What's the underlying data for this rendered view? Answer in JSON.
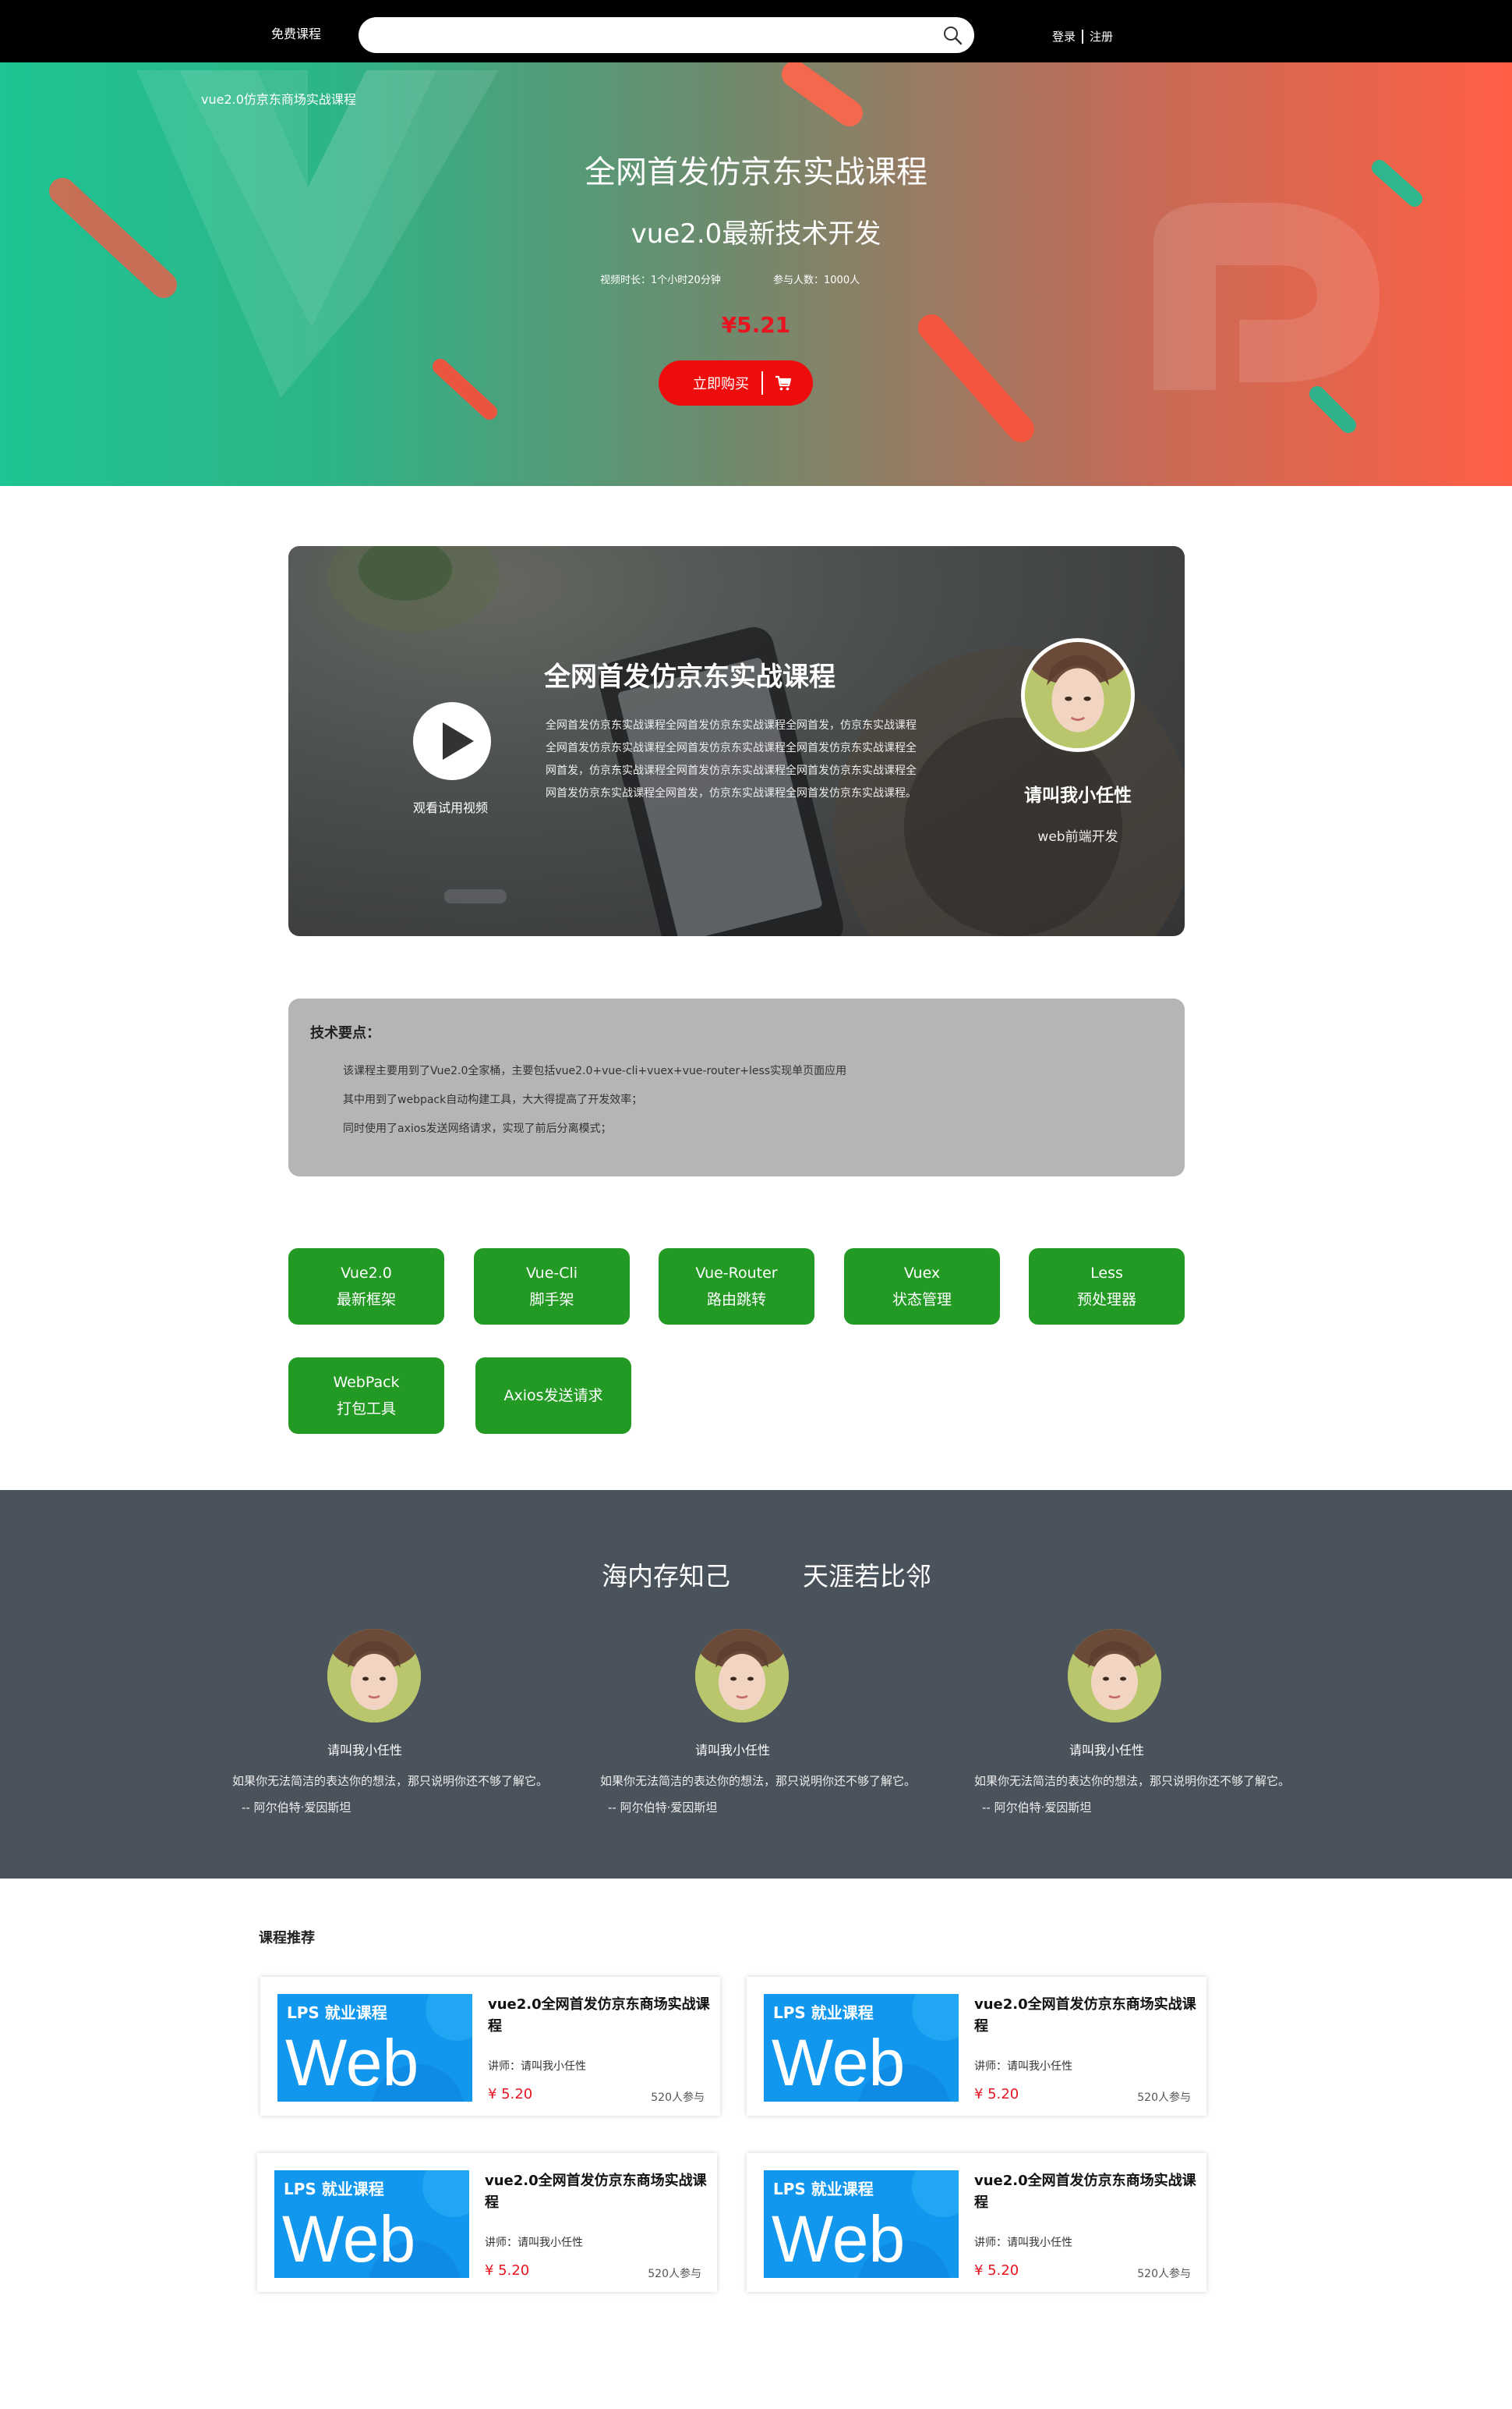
{
  "topbar": {
    "free_course": "免费课程",
    "search_value": "",
    "search_placeholder": "",
    "login": "登录",
    "register": "注册"
  },
  "hero": {
    "breadcrumb": "vue2.0仿京东商场实战课程",
    "title": "全网首发仿京东实战课程",
    "subtitle": "vue2.0最新技术开发",
    "duration": "视频时长：1个小时20分钟",
    "participants": "参与人数：1000人",
    "price": "¥5.21",
    "buy_label": "立即购买",
    "colors": {
      "start": "#1ec493",
      "end": "#ff5f45"
    }
  },
  "intro": {
    "play_label": "观看试用视频",
    "title": "全网首发仿京东实战课程",
    "description": "全网首发仿京东实战课程全网首发仿京东实战课程全网首发，仿京东实战课程全网首发仿京东实战课程全网首发仿京东实战课程全网首发仿京东实战课程全网首发，仿京东实战课程全网首发仿京东实战课程全网首发仿京东实战课程全网首发仿京东实战课程全网首发，仿京东实战课程全网首发仿京东实战课程。",
    "teacher_name": "请叫我小任性",
    "teacher_role": "web前端开发"
  },
  "tech": {
    "heading": "技术要点：",
    "lines": [
      "该课程主要用到了Vue2.0全家桶，主要包括vue2.0+vue-cli+vuex+vue-router+less实现单页面应用",
      "其中用到了webpack自动构建工具，大大得提高了开发效率；",
      "同时使用了axios发送网络请求，实现了前后分离模式；"
    ]
  },
  "tags": [
    {
      "line1": "Vue2.0",
      "line2": "最新框架"
    },
    {
      "line1": "Vue-Cli",
      "line2": "脚手架"
    },
    {
      "line1": "Vue-Router",
      "line2": "路由跳转"
    },
    {
      "line1": "Vuex",
      "line2": "状态管理"
    },
    {
      "line1": "Less",
      "line2": "预处理器"
    },
    {
      "line1": "WebPack",
      "line2": "打包工具"
    },
    {
      "line1": "Axios发送请求",
      "line2": ""
    }
  ],
  "band": {
    "left": "海内存知己",
    "right": "天涯若比邻",
    "people": [
      {
        "name": "请叫我小任性",
        "quote": "如果你无法简洁的表达你的想法，那只说明你还不够了解它。",
        "author": "-- 阿尔伯特·爱因斯坦"
      },
      {
        "name": "请叫我小任性",
        "quote": "如果你无法简洁的表达你的想法，那只说明你还不够了解它。",
        "author": "-- 阿尔伯特·爱因斯坦"
      },
      {
        "name": "请叫我小任性",
        "quote": "如果你无法简洁的表达你的想法，那只说明你还不够了解它。",
        "author": "-- 阿尔伯特·爱因斯坦"
      }
    ]
  },
  "recommend": {
    "heading": "课程推荐",
    "courses": [
      {
        "badge": "LPS 就业课程",
        "logo": "Web",
        "title": "vue2.0全网首发仿京东商场实战课程",
        "teacher": "讲师：请叫我小任性",
        "price": "¥ 5.20",
        "joined": "520人参与"
      },
      {
        "badge": "LPS 就业课程",
        "logo": "Web",
        "title": "vue2.0全网首发仿京东商场实战课程",
        "teacher": "讲师：请叫我小任性",
        "price": "¥ 5.20",
        "joined": "520人参与"
      },
      {
        "badge": "LPS 就业课程",
        "logo": "Web",
        "title": "vue2.0全网首发仿京东商场实战课程",
        "teacher": "讲师：请叫我小任性",
        "price": "¥ 5.20",
        "joined": "520人参与"
      },
      {
        "badge": "LPS 就业课程",
        "logo": "Web",
        "title": "vue2.0全网首发仿京东商场实战课程",
        "teacher": "讲师：请叫我小任性",
        "price": "¥ 5.20",
        "joined": "520人参与"
      }
    ]
  },
  "icons": {
    "search": "search-icon",
    "cart": "cart-icon",
    "play": "play-icon"
  }
}
